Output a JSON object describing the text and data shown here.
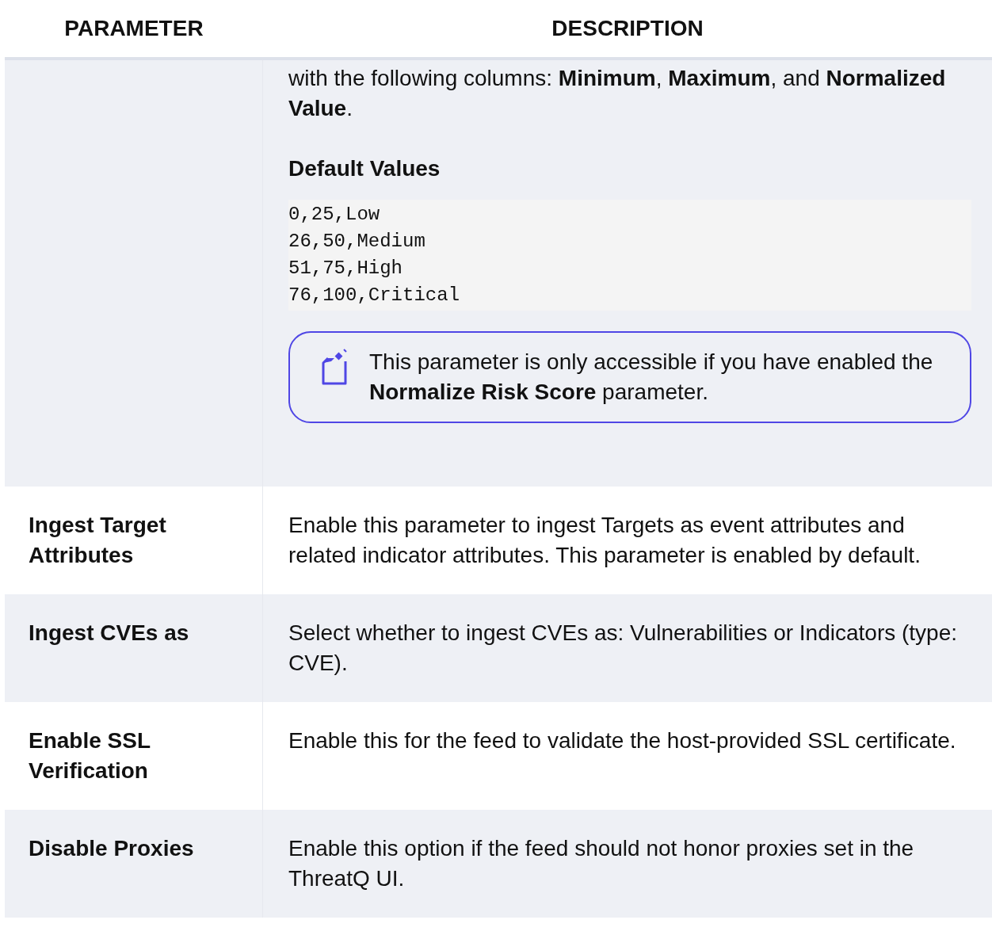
{
  "table": {
    "columns": [
      "PARAMETER",
      "DESCRIPTION"
    ],
    "rows": [
      {
        "parameter": "",
        "description": [
          {
            "kind": "paragraph",
            "text": "with the following columns: **Minimum**, **Maximum**, and **Normalized Value**."
          },
          {
            "kind": "heading",
            "text": "Default Values"
          },
          {
            "kind": "code",
            "lines": [
              "0,25,Low",
              "26,50,Medium",
              "51,75,High",
              "76,100,Critical"
            ]
          },
          {
            "kind": "note",
            "text": "This parameter is only accessible if you have enabled the **Normalize Risk Score** parameter."
          }
        ]
      },
      {
        "parameter": "Ingest Target Attributes",
        "description": [
          {
            "kind": "paragraph",
            "text": "Enable this parameter to ingest Targets as event attributes and related indicator attributes. This parameter is enabled by default."
          }
        ]
      },
      {
        "parameter": "Ingest CVEs as",
        "description": [
          {
            "kind": "paragraph",
            "text": "Select whether to ingest CVEs as: Vulnerabilities or Indicators (type: CVE)."
          }
        ]
      },
      {
        "parameter": "Enable SSL Verification",
        "description": [
          {
            "kind": "paragraph",
            "text": "Enable this for the feed to validate the host-provided SSL certificate."
          }
        ]
      },
      {
        "parameter": "Disable Proxies",
        "description": [
          {
            "kind": "paragraph",
            "text": "Enable this option if the feed should not honor proxies set in the ThreatQ UI."
          }
        ]
      }
    ]
  }
}
